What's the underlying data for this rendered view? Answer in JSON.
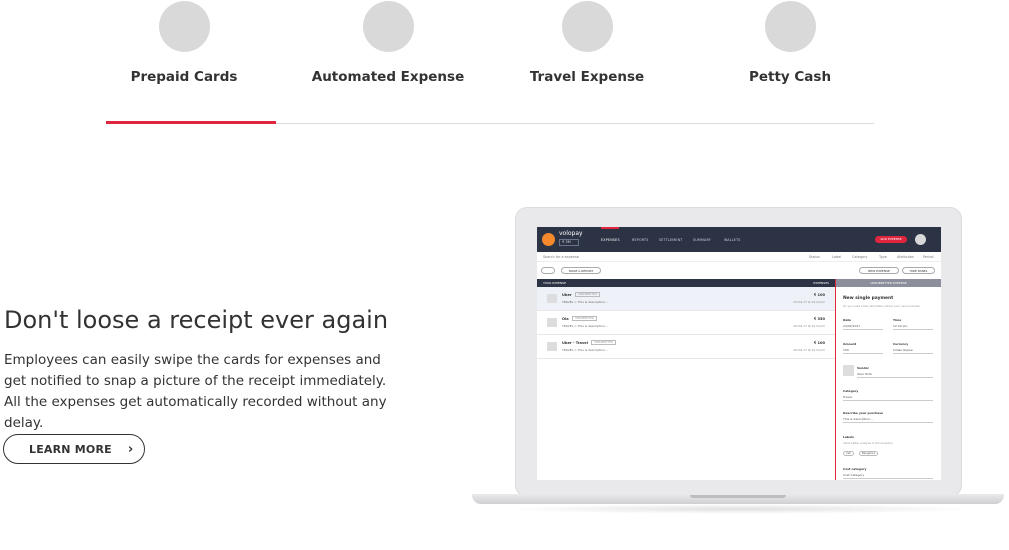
{
  "tabs": [
    {
      "label": "Prepaid Cards",
      "active": true
    },
    {
      "label": "Automated Expense",
      "active": false
    },
    {
      "label": "Travel Expense",
      "active": false
    },
    {
      "label": "Petty Cash",
      "active": false
    }
  ],
  "accent_color": "#e0263f",
  "hero": {
    "title": "Don't loose a receipt ever again",
    "body": "Employees can easily swipe the cards for expenses and get notified to snap a picture of the receipt immediately. All the expenses get automatically recorded without any delay.",
    "button_label": "LEARN MORE",
    "button_icon": "chevron-right-icon"
  },
  "app": {
    "brand": "volopay",
    "balance": "₹ 3M",
    "nav": [
      "EXPENSES",
      "REPORTS",
      "SETTLEMENT",
      "SUMMARY",
      "WALLETS"
    ],
    "add_button": "ADD EXPENSE",
    "search_placeholder": "Search for a expense",
    "filters": [
      "Status",
      "Label",
      "Category",
      "Type",
      "Attributes",
      "Period"
    ],
    "make_report": "MAKE A REPORT",
    "new_expense": "NEW EXPENSE",
    "hide_panel": "HIDE PANEL",
    "list_header": "YOUR EXPENSE",
    "list_header_right": "EXPENSES",
    "panel_header": "UNSUBMITTED EXPENSE",
    "expenses": [
      {
        "merchant": "Uber",
        "tag": "UNSUBMITTED",
        "category": "TRAVEL",
        "desc": "This is description...",
        "amount": "₹ 100",
        "date": "24 Feb 17 at 12:24 pm"
      },
      {
        "merchant": "Ola",
        "tag": "UNSUBMITTED",
        "category": "TRAVEL",
        "desc": "This is description...",
        "amount": "₹ 350",
        "date": "24 Feb 17 at 12:24 pm"
      },
      {
        "merchant": "Uber - Travel",
        "tag": "UNSUBMITTED",
        "category": "TRAVEL",
        "desc": "This is description...",
        "amount": "₹ 100",
        "date": "24 Feb 17 at 12:24 pm"
      }
    ],
    "form": {
      "title": "New single payment",
      "subtitle": "Do you need a few information about your new purchase",
      "date_label": "Date",
      "date_value": "24/02/2017",
      "time_label": "Time",
      "time_value": "12:24 pm",
      "amount_label": "Amount",
      "amount_value": "100",
      "currency_label": "Currency",
      "currency_value": "Indian Rupee",
      "vendor_label": "Vendor",
      "vendor_value": "Uber Ride",
      "category_label": "Category",
      "category_value": "Travel",
      "purchase_label": "Describe your purchase",
      "purchase_value": "This is description...",
      "labels_label": "Labels",
      "labels_hint": "Allow better analysis in the Analytics",
      "label_pills": [
        "cab",
        "Bangalore"
      ],
      "cost_label": "Cost category",
      "cost_value": "Cost Category"
    }
  }
}
